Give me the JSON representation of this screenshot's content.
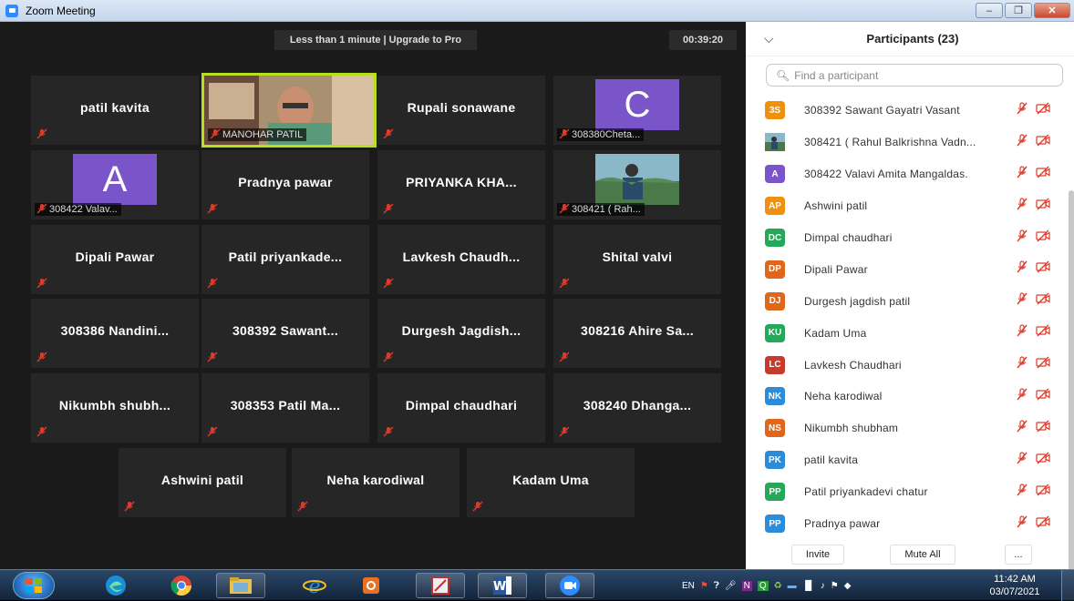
{
  "window": {
    "title": "Zoom Meeting"
  },
  "meeting": {
    "banner": "Less than 1 minute | Upgrade to Pro",
    "timer": "00:39:20",
    "tiles": [
      {
        "name": "patil kavita"
      },
      {
        "label": "MANOHAR PATIL",
        "type": "video"
      },
      {
        "name": "Rupali sonawane"
      },
      {
        "avatar": "C",
        "label": "308380Cheta..."
      },
      {
        "avatar": "A",
        "label": "308422 Valav..."
      },
      {
        "name": "Pradnya pawar"
      },
      {
        "name": "PRIYANKA KHA..."
      },
      {
        "label": "308421 ( Rah...",
        "type": "video"
      },
      {
        "name": "Dipali Pawar"
      },
      {
        "name": "Patil priyankade..."
      },
      {
        "name": "Lavkesh Chaudh..."
      },
      {
        "name": "Shital valvi"
      },
      {
        "name": "308386 Nandini..."
      },
      {
        "name": "308392 Sawant..."
      },
      {
        "name": "Durgesh Jagdish..."
      },
      {
        "name": "308216 Ahire Sa..."
      },
      {
        "name": "Nikumbh shubh..."
      },
      {
        "name": "308353 Patil Ma..."
      },
      {
        "name": "Dimpal chaudhari"
      },
      {
        "name": "308240 Dhanga..."
      },
      {
        "name": "Ashwini patil"
      },
      {
        "name": "Neha karodiwal"
      },
      {
        "name": "Kadam Uma"
      }
    ]
  },
  "participants": {
    "title": "Participants (23)",
    "search_placeholder": "Find a participant",
    "items": [
      {
        "initials": "3S",
        "color": "#f0900f",
        "name": "308392 Sawant Gayatri Vasant"
      },
      {
        "initials": "",
        "color": "#3a5a7a",
        "name": "308421 ( Rahul Balkrishna Vadn...",
        "photo": true
      },
      {
        "initials": "A",
        "color": "#7a55c9",
        "name": "308422 Valavi Amita Mangaldas."
      },
      {
        "initials": "AP",
        "color": "#f0900f",
        "name": "Ashwini patil"
      },
      {
        "initials": "DC",
        "color": "#25a85a",
        "name": "Dimpal chaudhari"
      },
      {
        "initials": "DP",
        "color": "#e0661a",
        "name": "Dipali Pawar"
      },
      {
        "initials": "DJ",
        "color": "#e0661a",
        "name": "Durgesh jagdish patil"
      },
      {
        "initials": "KU",
        "color": "#25a85a",
        "name": "Kadam Uma"
      },
      {
        "initials": "LC",
        "color": "#c83a2a",
        "name": "Lavkesh Chaudhari"
      },
      {
        "initials": "NK",
        "color": "#2d8cd8",
        "name": "Neha karodiwal"
      },
      {
        "initials": "NS",
        "color": "#e0661a",
        "name": "Nikumbh shubham"
      },
      {
        "initials": "PK",
        "color": "#2d8cd8",
        "name": "patil kavita"
      },
      {
        "initials": "PP",
        "color": "#25a85a",
        "name": "Patil priyankadevi chatur"
      },
      {
        "initials": "PP",
        "color": "#2d8cd8",
        "name": "Pradnya pawar"
      }
    ],
    "footer": {
      "invite": "Invite",
      "mute_all": "Mute All",
      "more": "..."
    }
  },
  "taskbar": {
    "lang": "EN",
    "time": "11:42 AM",
    "date": "03/07/2021"
  },
  "colors": {
    "active_speaker": "#b4e020",
    "muted": "#e03a2a",
    "tile_bg": "#262626"
  }
}
